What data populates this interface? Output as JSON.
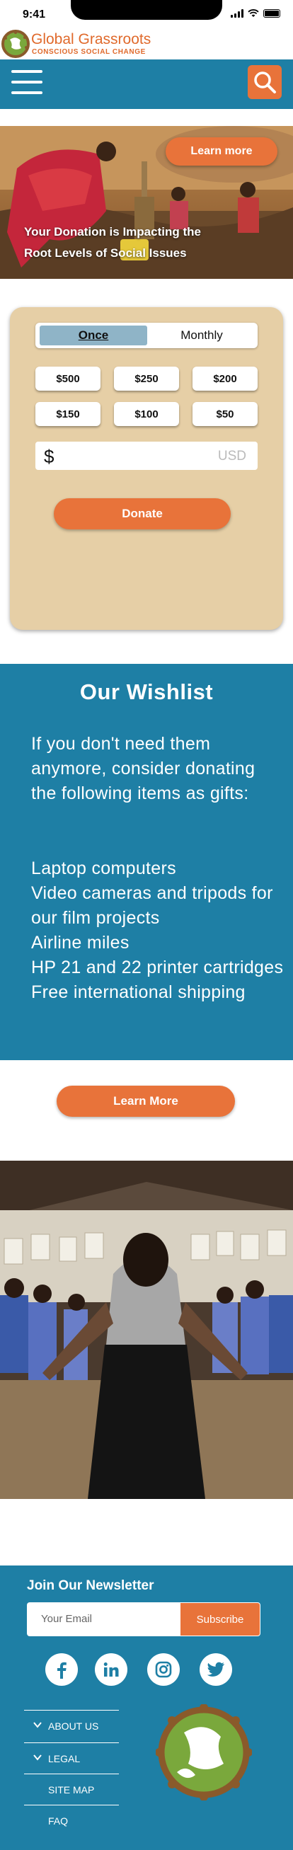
{
  "status": {
    "time": "9:41"
  },
  "brand": {
    "name": "Global Grassroots",
    "tagline": "CONSCIOUS SOCIAL CHANGE"
  },
  "hero": {
    "tagline_line1": "Your Donation is Impacting the",
    "tagline_line2": "Root Levels of Social Issues",
    "learn_more": "Learn more"
  },
  "donate": {
    "frequency": [
      "Once",
      "Monthly"
    ],
    "selected_frequency": "Once",
    "amounts": [
      "$500",
      "$250",
      "$200",
      "$150",
      "$100",
      "$50"
    ],
    "currency_symbol": "$",
    "currency_code": "USD",
    "button": "Donate"
  },
  "wishlist": {
    "title": "Our Wishlist",
    "intro": "If you don't need them anymore, consider donating the following items as gifts:",
    "items": [
      "Laptop computers",
      "Video cameras and tripods for our film projects",
      "Airline miles",
      "HP 21 and 22 printer cartridges",
      "Free international shipping"
    ],
    "learn_more": "Learn More"
  },
  "footer": {
    "newsletter_title": "Join Our Newsletter",
    "email_placeholder": "Your Email",
    "subscribe": "Subscribe",
    "social": [
      "facebook-icon",
      "linkedin-icon",
      "instagram-icon",
      "twitter-icon"
    ],
    "links": [
      "ABOUT US",
      "LEGAL",
      "SITE MAP",
      "FAQ"
    ]
  },
  "colors": {
    "primary": "#1e7fa5",
    "accent": "#e8733a",
    "card": "#e6cfa6"
  }
}
